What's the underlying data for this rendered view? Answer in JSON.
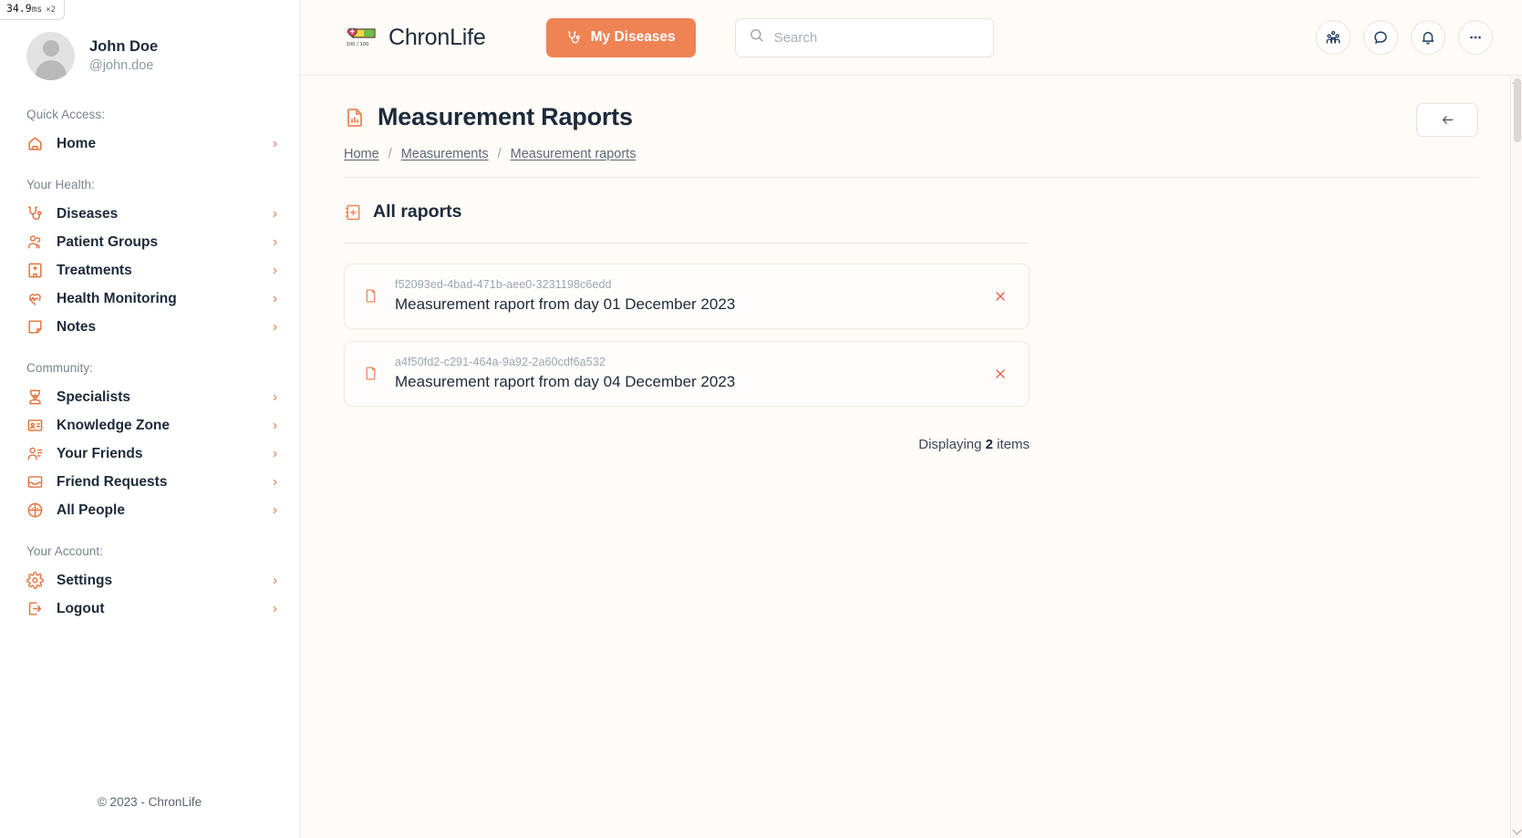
{
  "perf_badge": {
    "value": "34.9",
    "unit": "ms",
    "multiplier": "×2"
  },
  "sidebar": {
    "profile": {
      "name": "John Doe",
      "handle": "@john.doe",
      "avatar_icon": "user-avatar-icon"
    },
    "groups": [
      {
        "label": "Quick Access:",
        "items": [
          {
            "label": "Home",
            "icon": "home-icon"
          }
        ]
      },
      {
        "label": "Your Health:",
        "items": [
          {
            "label": "Diseases",
            "icon": "stethoscope-icon"
          },
          {
            "label": "Patient Groups",
            "icon": "people-group-icon"
          },
          {
            "label": "Treatments",
            "icon": "hospital-icon"
          },
          {
            "label": "Health Monitoring",
            "icon": "heart-pulse-icon"
          },
          {
            "label": "Notes",
            "icon": "note-icon"
          }
        ]
      },
      {
        "label": "Community:",
        "items": [
          {
            "label": "Specialists",
            "icon": "doctor-icon"
          },
          {
            "label": "Knowledge Zone",
            "icon": "id-card-icon"
          },
          {
            "label": "Your Friends",
            "icon": "user-list-icon"
          },
          {
            "label": "Friend Requests",
            "icon": "inbox-icon"
          },
          {
            "label": "All People",
            "icon": "globe-people-icon"
          }
        ]
      },
      {
        "label": "Your Account:",
        "items": [
          {
            "label": "Settings",
            "icon": "gear-icon"
          },
          {
            "label": "Logout",
            "icon": "logout-icon"
          }
        ]
      }
    ],
    "footer": "© 2023 - ChronLife"
  },
  "topbar": {
    "brand_name": "ChronLife",
    "brand_logo_icon": "health-bar-logo-icon",
    "brand_logo_text": "100 / 100",
    "my_diseases_label": "My Diseases",
    "my_diseases_icon": "stethoscope-icon",
    "search": {
      "placeholder": "Search",
      "value": "",
      "icon": "search-icon"
    },
    "actions": [
      {
        "name": "people-group-icon",
        "title": "Groups"
      },
      {
        "name": "chat-bubble-icon",
        "title": "Messages"
      },
      {
        "name": "bell-icon",
        "title": "Notifications"
      },
      {
        "name": "ellipsis-icon",
        "title": "More"
      }
    ]
  },
  "page": {
    "title": "Measurement Raports",
    "title_icon": "report-chart-icon",
    "back_icon": "arrow-left-icon",
    "breadcrumb": [
      {
        "label": "Home"
      },
      {
        "label": "Measurements"
      },
      {
        "label": "Measurement raports"
      }
    ],
    "breadcrumb_separator": "/",
    "section": {
      "title": "All raports",
      "icon": "notebook-plus-icon"
    },
    "reports": [
      {
        "id": "f52093ed-4bad-471b-aee0-3231198c6edd",
        "title": "Measurement raport from day 01 December 2023",
        "doc_icon": "document-icon",
        "delete_icon": "close-icon"
      },
      {
        "id": "a4f50fd2-c291-464a-9a92-2a60cdf6a532",
        "title": "Measurement raport from day 04 December 2023",
        "doc_icon": "document-icon",
        "delete_icon": "close-icon"
      }
    ],
    "displaying": {
      "prefix": "Displaying",
      "count": "2",
      "suffix": "items"
    }
  },
  "colors": {
    "accent": "#ef8354",
    "accent_dark": "#e2703a",
    "text": "#1c2a3a",
    "muted": "#9aa5b1",
    "bg": "#fffbf7",
    "danger": "#e2533a"
  }
}
